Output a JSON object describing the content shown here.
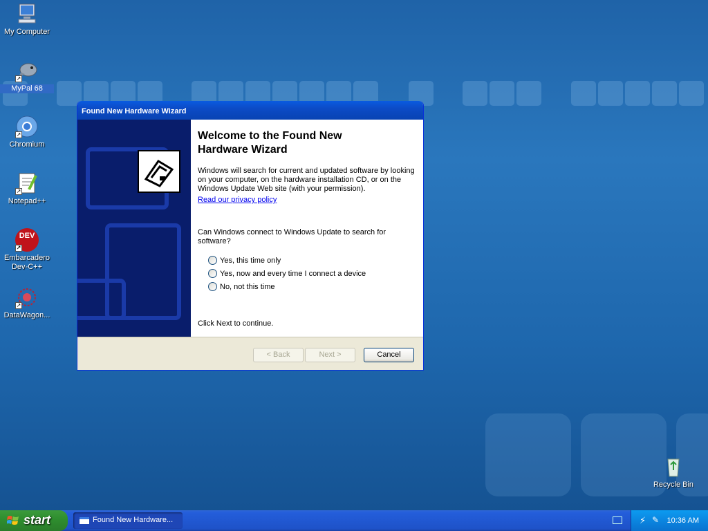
{
  "desktop": {
    "icons": [
      {
        "label": "My Computer"
      },
      {
        "label": "MyPal 68"
      },
      {
        "label": "Chromium"
      },
      {
        "label": "Notepad++"
      },
      {
        "label": "Embarcadero Dev-C++"
      },
      {
        "label": "DataWagon..."
      },
      {
        "label": "Recycle Bin"
      }
    ],
    "devcpp_badge": "DEV"
  },
  "wizard": {
    "window_title": "Found New Hardware Wizard",
    "heading": "Welcome to the Found New Hardware Wizard",
    "description": "Windows will search for current and updated software by looking on your computer, on the hardware installation CD, or on the Windows Update Web site (with your permission).",
    "privacy_link": "Read our privacy policy",
    "question": "Can Windows connect to Windows Update to search for software?",
    "options": [
      {
        "label": "Yes, this time only",
        "selected": false
      },
      {
        "label": "Yes, now and every time I connect a device",
        "selected": false
      },
      {
        "label": "No, not this time",
        "selected": false
      }
    ],
    "continue_text": "Click Next to continue.",
    "buttons": {
      "back": "< Back",
      "next": "Next >",
      "cancel": "Cancel"
    }
  },
  "taskbar": {
    "start_label": "start",
    "tasks": [
      {
        "label": "Found New Hardware..."
      }
    ],
    "clock": "10:36 AM"
  },
  "colors": {
    "desktop_blue": "#2a77bd",
    "title_blue": "#0843b3",
    "start_green": "#2f8f2f",
    "tray_blue": "#0b86e0"
  }
}
